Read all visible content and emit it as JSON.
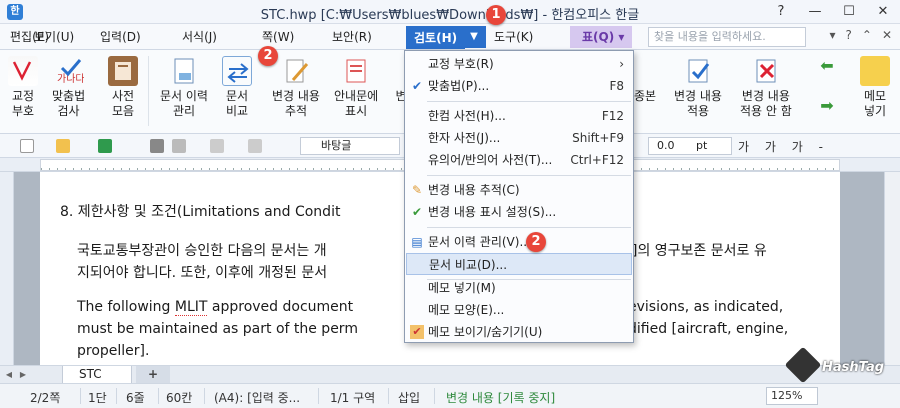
{
  "title_bar": {
    "title": "STC.hwp [C:₩Users₩blues₩Downloads₩] - 한컴오피스 한글",
    "app_icon_char": "한"
  },
  "menu_bar": {
    "items": [
      {
        "label": "편집(E)",
        "name": "menu-edit"
      },
      {
        "label": "보기(U)",
        "name": "menu-view"
      },
      {
        "label": "입력(D)",
        "name": "menu-insert"
      },
      {
        "label": "서식(J)",
        "name": "menu-format"
      },
      {
        "label": "쪽(W)",
        "name": "menu-page"
      },
      {
        "label": "보안(R)",
        "name": "menu-security"
      }
    ],
    "active_label": "검토(H)",
    "after_active": [
      {
        "label": "도구(K)",
        "name": "menu-tools"
      }
    ],
    "table_label": "표(Q)",
    "search_placeholder": "찾을 내용을 입력하세요."
  },
  "ribbon": {
    "buttons": [
      {
        "label": "교정\n부호",
        "name": "proofread-marks-button"
      },
      {
        "label": "맞춤법\n검사",
        "name": "spellcheck-button"
      },
      {
        "label": "사전\n모음",
        "name": "dictionary-button"
      },
      {
        "label": "문서 이력\n관리",
        "name": "doc-history-button"
      },
      {
        "label": "문서\n비교",
        "name": "doc-compare-button"
      },
      {
        "label": "변경 내용\n추적",
        "name": "track-changes-button"
      },
      {
        "label": "안내문에\n표시",
        "name": "show-in-guide-button"
      },
      {
        "label": "변경 내용\n적용",
        "name": "apply-changes-button"
      },
      {
        "label": "변경 내용\n적용 안 함",
        "name": "reject-changes-button"
      },
      {
        "label": "메모\n넣기",
        "name": "insert-memo-button"
      }
    ],
    "partial_labels": [
      "변",
      "종본"
    ]
  },
  "format_bar": {
    "style": "바탕글",
    "size_value": "0.0",
    "size_unit": "pt",
    "char_format_glyphs": "가 가 가 -"
  },
  "document": {
    "heading": "8. 제한사항 및 조건(Limitations and Condit",
    "korean_line1a": "국토교통부장관이 승인한 다음의 문서는 개",
    "korean_line1b": "]의 영구보존 문서로 유",
    "korean_line2": "지되어야 합니다. 또한, 이후에 개정된 문서",
    "english_line1a": "The following ",
    "english_mlit": "MLIT",
    "english_line1b": " approved document",
    "english_line1c": "evisions, as indicated,",
    "english_line2a": "must be maintained as part of the perm",
    "english_line2b": "dified [aircraft, engine,",
    "english_line3": "propeller]."
  },
  "dropdown": {
    "items": [
      {
        "label": "교정 부호(R)",
        "key": "",
        "arrow": true,
        "icon": "",
        "name": "dd-proofread-marks"
      },
      {
        "label": "맞춤법(P)...",
        "key": "F8",
        "icon": "spellcheck-icon",
        "name": "dd-spellcheck"
      },
      {
        "label": "한컴 사전(H)...",
        "key": "F12",
        "icon": "",
        "name": "dd-hancom-dictionary"
      },
      {
        "label": "한자 사전(J)...",
        "key": "Shift+F9",
        "icon": "",
        "name": "dd-hanja-dictionary"
      },
      {
        "label": "유의어/반의어 사전(T)...",
        "key": "Ctrl+F12",
        "icon": "",
        "name": "dd-thesaurus"
      },
      {
        "label": "변경 내용 추적(C)",
        "key": "",
        "icon": "track-changes-icon",
        "name": "dd-track-changes"
      },
      {
        "label": "변경 내용 표시 설정(S)...",
        "key": "",
        "icon": "change-display-icon",
        "name": "dd-change-display-settings"
      },
      {
        "label": "문서 이력 관리(V)...",
        "key": "",
        "icon": "doc-history-icon",
        "name": "dd-doc-history"
      },
      {
        "label": "문서 비교(D)...",
        "key": "",
        "icon": "",
        "name": "dd-doc-compare"
      },
      {
        "label": "메모 넣기(M)",
        "key": "",
        "icon": "",
        "name": "dd-insert-memo"
      },
      {
        "label": "메모 모양(E)...",
        "key": "",
        "icon": "",
        "name": "dd-memo-shape"
      },
      {
        "label": "메모 보이기/숨기기(U)",
        "key": "",
        "icon": "memo-toggle-icon",
        "name": "dd-memo-toggle"
      }
    ]
  },
  "callouts": [
    "1",
    "2",
    "2"
  ],
  "tab_bar": {
    "doc_tab": "STC",
    "add_tab": "+"
  },
  "status_bar": {
    "page": "2/2쪽",
    "column": "1단",
    "line": "6줄",
    "col": "60칸",
    "paper": "(A4): [입력 중...",
    "section": "1/1 구역",
    "mode": "삽입",
    "track": "변경 내용 [기록 중지]",
    "zoom": "125%"
  },
  "watermark": "HashTag",
  "colors": {
    "accent": "#2a6fcb",
    "table_menu_bg": "#d6c8ef",
    "callout": "#e8463a",
    "status_green": "#2f8a3d"
  }
}
